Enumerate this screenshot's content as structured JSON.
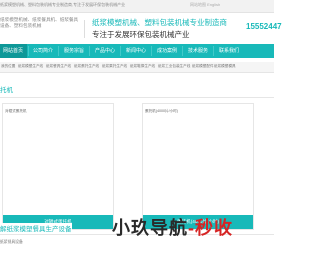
{
  "topbar": {
    "left": "纸浆模塑机械、塑料包装机械专业制造商,专注于发展环保包装机械产业",
    "right": "网站地图 English"
  },
  "header": {
    "left_text": "纸浆模塑机械、纸浆餐具机、纸浆餐具设备、塑料包装机械",
    "brand_line1": "纸浆模塑机械、塑料包装机械专业制造商",
    "brand_line2": "专注于发展环保包装机械产业",
    "phone": "15552447"
  },
  "nav": {
    "items": [
      "网站首页",
      "公司简介",
      "服务宗旨",
      "产品中心",
      "新闻中心",
      "成功案例",
      "技术服务",
      "联系我们"
    ]
  },
  "subnav": {
    "items": [
      "我的位置",
      "纸浆模塑生产线",
      "纸浆餐具生产线",
      "纸浆蛋托生产线",
      "纸浆果托生产线",
      "纸浆鞋撑生产线",
      "纸浆工业包装生产线",
      "纸浆模塑配件",
      "纸浆模塑模具"
    ]
  },
  "section": {
    "title": "托机"
  },
  "products": [
    {
      "caption": "对辊式蛋托机",
      "button": "对辊式蛋托机"
    },
    {
      "caption": "蛋托机(4000片/小时)",
      "button": "蛋托机(4000片/小时)"
    }
  ],
  "section2": {
    "title": "解纸浆模塑餐具生产设备"
  },
  "bottom": {
    "text": "纸浆餐具设备"
  },
  "watermark": {
    "part1": "小玖导航",
    "dash": "-",
    "part2": "秒收"
  }
}
